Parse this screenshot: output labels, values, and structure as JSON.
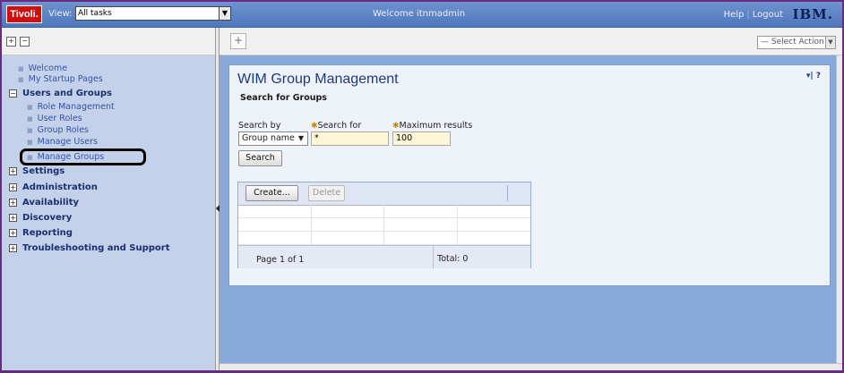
{
  "banner": {
    "logo_text": "Tivoli.",
    "view_label": "View:",
    "view_value": "All tasks",
    "welcome": "Welcome  itnmadmin",
    "help_link": "Help",
    "logout_link": "Logout",
    "ibm_logo": "IBM.",
    "colors": {
      "banner": "#5b81c4",
      "logo": "#d20d0d"
    }
  },
  "nav": {
    "expand_all": "+",
    "collapse_all": "−",
    "items": [
      {
        "label": "Welcome"
      },
      {
        "label": "My Startup Pages"
      }
    ],
    "users_and_groups": {
      "label": "Users and Groups",
      "toggle": "−",
      "children": [
        {
          "label": "Role Management"
        },
        {
          "label": "User Roles"
        },
        {
          "label": "Group Roles"
        },
        {
          "label": "Manage Users"
        },
        {
          "label": "Manage Groups"
        }
      ]
    },
    "groups": [
      {
        "label": "Settings",
        "toggle": "+"
      },
      {
        "label": "Administration",
        "toggle": "+"
      },
      {
        "label": "Availability",
        "toggle": "+"
      },
      {
        "label": "Discovery",
        "toggle": "+"
      },
      {
        "label": "Reporting",
        "toggle": "+"
      },
      {
        "label": "Troubleshooting and Support",
        "toggle": "+"
      }
    ]
  },
  "toolbar": {
    "new_tab_icon": "+",
    "select_action": "— Select Action —"
  },
  "portlet": {
    "title": "WIM Group Management",
    "actions": "▾| ?",
    "section_title": "Search for Groups",
    "search_by_label": "Search by",
    "search_by_value": "Group name",
    "search_for_label": "Search for",
    "search_for_value": "*",
    "max_results_label": "Maximum results",
    "max_results_value": "100",
    "search_button": "Search",
    "create_button": "Create...",
    "delete_button": "Delete",
    "page_info": "Page 1 of 1",
    "total_info": "Total: 0"
  }
}
